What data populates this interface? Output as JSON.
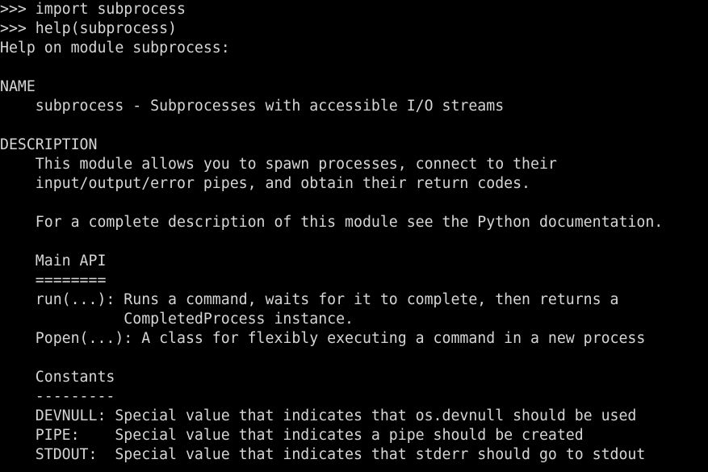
{
  "terminal": {
    "background_color": "#000000",
    "text_color": "#d6d6d6",
    "prompt": ">>> ",
    "columns": 80,
    "rows": 24,
    "lines": [
      {
        "id": "line-1",
        "kind": "input",
        "text": ">>> import subprocess"
      },
      {
        "id": "line-2",
        "kind": "input",
        "text": ">>> help(subprocess)"
      },
      {
        "id": "line-3",
        "kind": "output",
        "text": "Help on module subprocess:"
      },
      {
        "id": "line-4",
        "kind": "blank",
        "text": ""
      },
      {
        "id": "line-5",
        "kind": "output",
        "text": "NAME"
      },
      {
        "id": "line-6",
        "kind": "output",
        "text": "    subprocess - Subprocesses with accessible I/O streams"
      },
      {
        "id": "line-7",
        "kind": "blank",
        "text": ""
      },
      {
        "id": "line-8",
        "kind": "output",
        "text": "DESCRIPTION"
      },
      {
        "id": "line-9",
        "kind": "output",
        "text": "    This module allows you to spawn processes, connect to their"
      },
      {
        "id": "line-10",
        "kind": "output",
        "text": "    input/output/error pipes, and obtain their return codes."
      },
      {
        "id": "line-11",
        "kind": "blank",
        "text": ""
      },
      {
        "id": "line-12",
        "kind": "output",
        "text": "    For a complete description of this module see the Python documentation."
      },
      {
        "id": "line-13",
        "kind": "blank",
        "text": ""
      },
      {
        "id": "line-14",
        "kind": "output",
        "text": "    Main API"
      },
      {
        "id": "line-15",
        "kind": "output",
        "text": "    ========"
      },
      {
        "id": "line-16",
        "kind": "output",
        "text": "    run(...): Runs a command, waits for it to complete, then returns a"
      },
      {
        "id": "line-17",
        "kind": "output",
        "text": "              CompletedProcess instance."
      },
      {
        "id": "line-18",
        "kind": "output",
        "text": "    Popen(...): A class for flexibly executing a command in a new process"
      },
      {
        "id": "line-19",
        "kind": "blank",
        "text": ""
      },
      {
        "id": "line-20",
        "kind": "output",
        "text": "    Constants"
      },
      {
        "id": "line-21",
        "kind": "output",
        "text": "    ---------"
      },
      {
        "id": "line-22",
        "kind": "output",
        "text": "    DEVNULL: Special value that indicates that os.devnull should be used"
      },
      {
        "id": "line-23",
        "kind": "output",
        "text": "    PIPE:    Special value that indicates a pipe should be created"
      },
      {
        "id": "line-24",
        "kind": "output",
        "text": "    STDOUT:  Special value that indicates that stderr should go to stdout"
      }
    ]
  }
}
